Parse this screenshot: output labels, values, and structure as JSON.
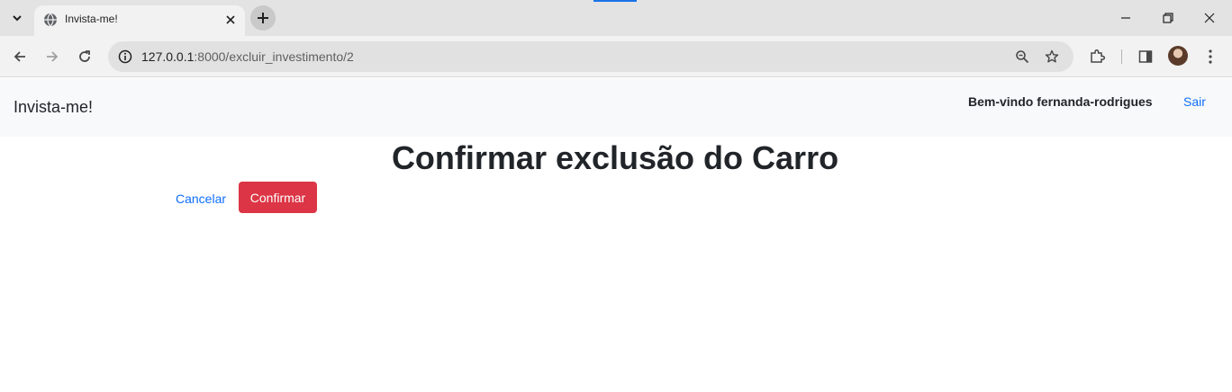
{
  "browser": {
    "tab_title": "Invista-me!",
    "url_host": "127.0.0.1",
    "url_rest": ":8000/excluir_investimento/2"
  },
  "navbar": {
    "brand": "Invista-me!",
    "welcome": "Bem-vindo fernanda-rodrigues",
    "logout": "Sair"
  },
  "main": {
    "title": "Confirmar exclusão do Carro",
    "cancel_label": "Cancelar",
    "confirm_label": "Confirmar"
  },
  "colors": {
    "accent": "#0d6efd",
    "danger": "#dc3545",
    "navbar_bg": "#f8f9fa"
  },
  "icons": [
    "tab-search-icon",
    "globe-icon",
    "close-icon",
    "plus-icon",
    "minimize-icon",
    "restore-icon",
    "back-icon",
    "forward-icon",
    "reload-icon",
    "info-icon",
    "zoom-icon",
    "star-icon",
    "extensions-icon",
    "side-panel-icon",
    "menu-icon"
  ]
}
